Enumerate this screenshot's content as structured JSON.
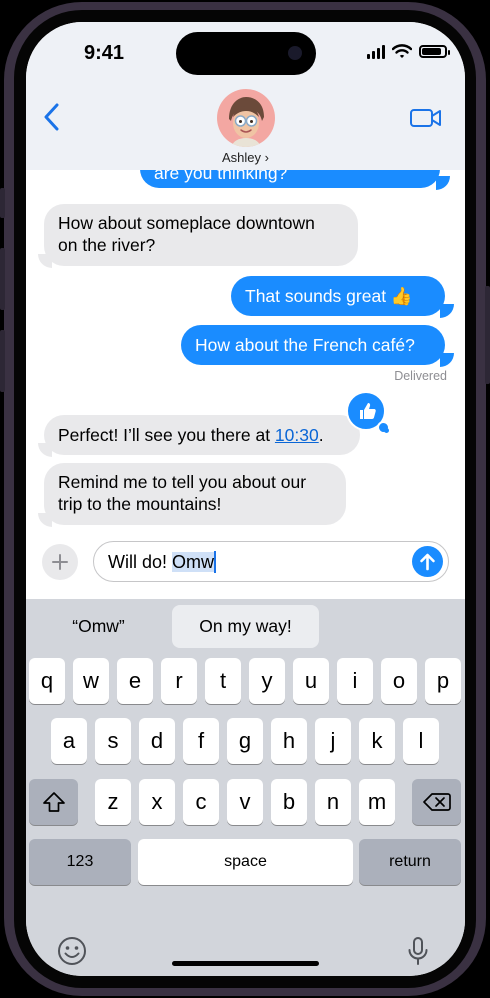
{
  "status_bar": {
    "time": "9:41"
  },
  "header": {
    "contact_name": "Ashley ›"
  },
  "messages": [
    {
      "dir": "out",
      "text": "are you thinking?"
    },
    {
      "dir": "in",
      "lines": [
        "How about someplace downtown",
        "on the river?"
      ]
    },
    {
      "dir": "out",
      "text": "That sounds great 👍"
    },
    {
      "dir": "out",
      "text": "How about the French café?"
    },
    {
      "dir": "in",
      "text_before": "Perfect! I’ll see you there at ",
      "link": "10:30",
      "text_after": "."
    },
    {
      "dir": "in",
      "lines": [
        "Remind me to tell you about our",
        "trip to the mountains!"
      ]
    }
  ],
  "delivered_label": "Delivered",
  "tapback": {
    "icon": "thumbs-up-icon"
  },
  "compose": {
    "text_plain": "Will do! ",
    "text_selected": "Omw"
  },
  "suggestions": [
    "“Omw”",
    "On my way!"
  ],
  "keyboard": {
    "row1": [
      "q",
      "w",
      "e",
      "r",
      "t",
      "y",
      "u",
      "i",
      "o",
      "p"
    ],
    "row2": [
      "a",
      "s",
      "d",
      "f",
      "g",
      "h",
      "j",
      "k",
      "l"
    ],
    "row3": [
      "z",
      "x",
      "c",
      "v",
      "b",
      "n",
      "m"
    ],
    "numbers_label": "123",
    "space_label": "space",
    "return_label": "return"
  },
  "colors": {
    "bubble_out": "#1a8cff",
    "bubble_in": "#e9e9eb",
    "keyboard_bg": "#d2d5db",
    "frame": "#3a3142"
  }
}
